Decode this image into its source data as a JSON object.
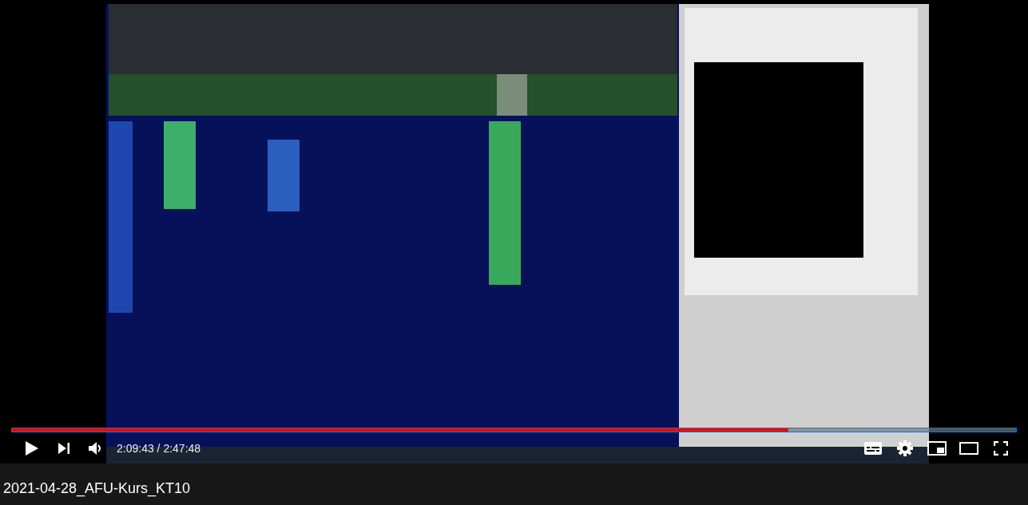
{
  "player": {
    "progress": {
      "level": 0.773
    },
    "time": "2:09:43 / 2:47:48"
  },
  "title": "2021-04-28_AFU-Kurs_KT10"
}
